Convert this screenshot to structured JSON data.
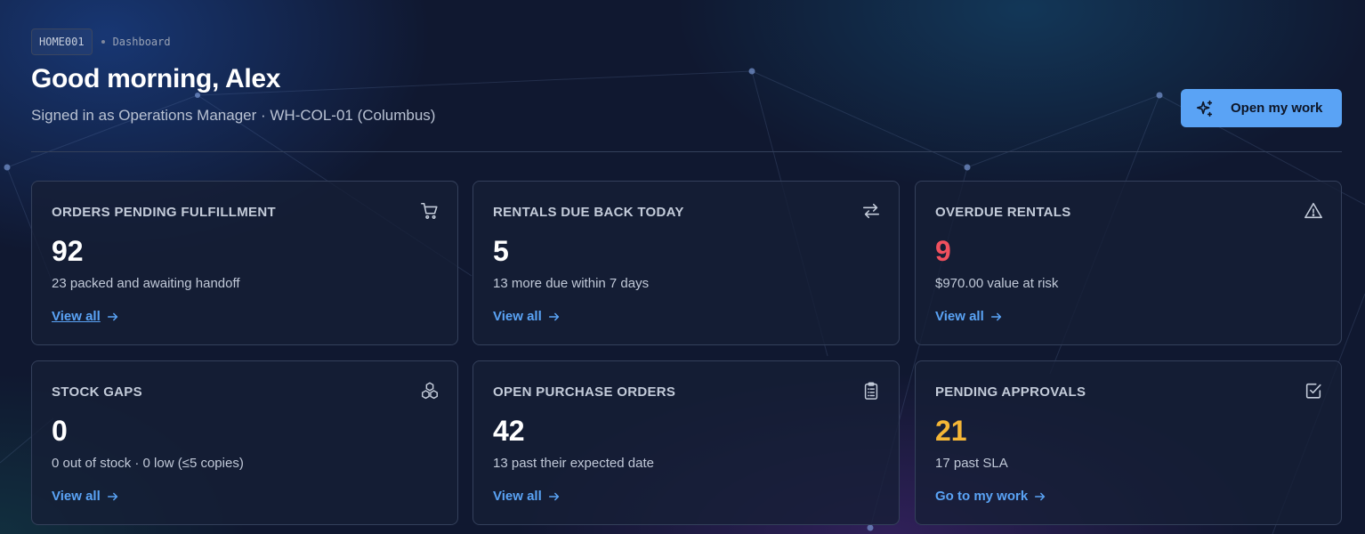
{
  "breadcrumb": {
    "code": "HOME001",
    "page": "Dashboard"
  },
  "header": {
    "title": "Good morning, Alex",
    "subtitle": "Signed in as Operations Manager · WH-COL-01 (Columbus)",
    "primary_button": "Open my work"
  },
  "colors": {
    "accent": "#5aa3f5",
    "danger": "#f0505e",
    "warning": "#f5b636",
    "background": "#101830"
  },
  "cards": [
    {
      "title": "ORDERS PENDING FULFILLMENT",
      "icon": "cart-icon",
      "value": "92",
      "subtitle": "23 packed and awaiting handoff",
      "link": "View all"
    },
    {
      "title": "RENTALS DUE BACK TODAY",
      "icon": "repeat-icon",
      "value": "5",
      "subtitle": "13 more due within 7 days",
      "link": "View all"
    },
    {
      "title": "OVERDUE RENTALS",
      "icon": "warning-icon",
      "value": "9",
      "subtitle": "$970.00 value at risk",
      "link": "View all"
    },
    {
      "title": "STOCK GAPS",
      "icon": "boxes-icon",
      "value": "0",
      "subtitle": "0 out of stock · 0 low (≤5 copies)",
      "link": "View all"
    },
    {
      "title": "OPEN PURCHASE ORDERS",
      "icon": "clipboard-icon",
      "value": "42",
      "subtitle": "13 past their expected date",
      "link": "View all"
    },
    {
      "title": "PENDING APPROVALS",
      "icon": "check-square-icon",
      "value": "21",
      "subtitle": "17 past SLA",
      "link": "Go to my work"
    }
  ]
}
